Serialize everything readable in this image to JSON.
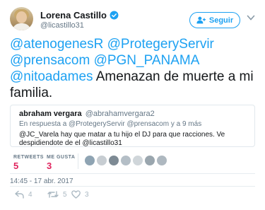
{
  "author": {
    "name": "Lorena Castillo",
    "handle": "@licastillo31"
  },
  "follow_button": {
    "label": "Seguir"
  },
  "tweet": {
    "mentions_line1": [
      "@atenogenesR",
      "@ProtegeryServir"
    ],
    "mentions_line2": [
      "@prensacom",
      "@PGN_PANAMA"
    ],
    "mention_line3": "@nitoadames",
    "text_line3": " Amenazan de muerte a mi",
    "text_line4": "familia."
  },
  "quoted_tweet": {
    "name": "abraham vergara",
    "handle": "@abrahamvergara2",
    "reply_context": "En respuesta a @ProtegeryServir @prensacom y a 9 más",
    "text": "@JC_Varela hay que matar a tu hijo el DJ para que racciones. Ve despidiendote de el @licastillo31"
  },
  "stats": {
    "retweets_label": "RETWEETS",
    "retweets_value": "5",
    "likes_label": "ME GUSTA",
    "likes_value": "3"
  },
  "timestamp": "14:45 - 17 abr. 2017",
  "actions": {
    "reply_count": "4",
    "retweet_count": "5",
    "like_count": "3"
  },
  "colors": {
    "accent": "#1da1f2",
    "like": "#e0245e",
    "muted": "#657786"
  },
  "icons": [
    "verified-badge-icon",
    "follow-user-icon",
    "caret-down-icon",
    "reply-icon",
    "retweet-icon",
    "like-icon"
  ]
}
